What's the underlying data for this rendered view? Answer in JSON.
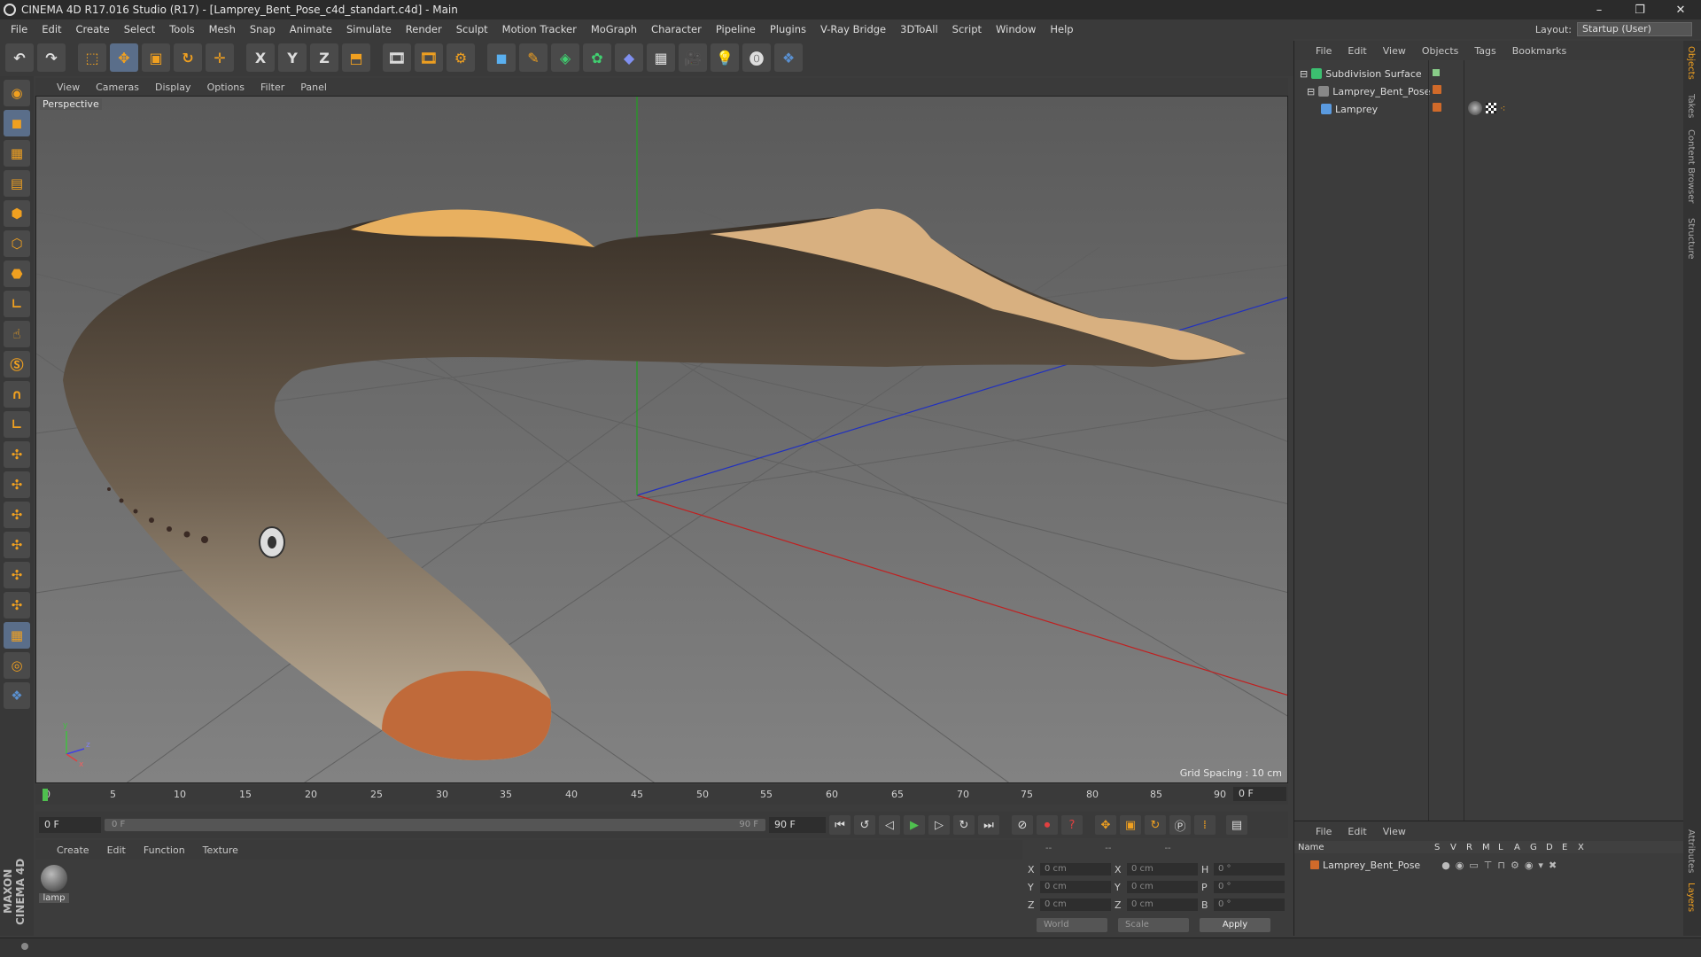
{
  "title": "CINEMA 4D R17.016 Studio (R17) - [Lamprey_Bent_Pose_c4d_standart.c4d] - Main",
  "window_controls": [
    "–",
    "❐",
    "✕"
  ],
  "menu": [
    "File",
    "Edit",
    "Create",
    "Select",
    "Tools",
    "Mesh",
    "Snap",
    "Animate",
    "Simulate",
    "Render",
    "Sculpt",
    "Motion Tracker",
    "MoGraph",
    "Character",
    "Pipeline",
    "Plugins",
    "V-Ray Bridge",
    "3DToAll",
    "Script",
    "Window",
    "Help"
  ],
  "layout": {
    "label": "Layout:",
    "value": "Startup (User)"
  },
  "toolbar_icons": [
    "undo-icon",
    "redo-icon",
    "live-select-icon",
    "move-icon",
    "scale-icon",
    "rotate-icon",
    "transform-icon",
    "x-axis-icon",
    "y-axis-icon",
    "z-axis-icon",
    "world-coord-icon",
    "render-view-icon",
    "render-picture-viewer-icon",
    "render-settings-icon",
    "cube-icon",
    "pen-spline-icon",
    "subdivision-icon",
    "array-icon",
    "deformer-icon",
    "floor-icon",
    "camera-icon",
    "light-icon",
    "vray-icon",
    "python-icon"
  ],
  "toolbar_glyphs": {
    "x": "X",
    "y": "Y",
    "z": "Z"
  },
  "viewport": {
    "menu": [
      "View",
      "Cameras",
      "Display",
      "Options",
      "Filter",
      "Panel"
    ],
    "label": "Perspective",
    "grid_spacing": "Grid Spacing : 10 cm",
    "axis_letters": {
      "y": "y",
      "z": "z",
      "x": "x"
    }
  },
  "timeline": {
    "ticks": [
      "0",
      "5",
      "10",
      "15",
      "20",
      "25",
      "30",
      "35",
      "40",
      "45",
      "50",
      "55",
      "60",
      "65",
      "70",
      "75",
      "80",
      "85",
      "90"
    ],
    "current_frame": "0 F"
  },
  "transport": {
    "start_field": "0 F",
    "range_start": "0 F",
    "range_end": "90 F",
    "end_field": "90 F"
  },
  "material_manager": {
    "menu": [
      "Create",
      "Edit",
      "Function",
      "Texture"
    ],
    "material_name": "lamp"
  },
  "coordinates": {
    "header": [
      "--",
      "--",
      "--"
    ],
    "rows": [
      {
        "a": "X",
        "av": "0 cm",
        "b": "X",
        "bv": "0 cm",
        "c": "H",
        "cv": "0 °"
      },
      {
        "a": "Y",
        "av": "0 cm",
        "b": "Y",
        "bv": "0 cm",
        "c": "P",
        "cv": "0 °"
      },
      {
        "a": "Z",
        "av": "0 cm",
        "b": "Z",
        "bv": "0 cm",
        "c": "B",
        "cv": "0 °"
      }
    ],
    "mode1": "World",
    "mode2": "Scale",
    "apply": "Apply"
  },
  "object_manager": {
    "menu": [
      "File",
      "Edit",
      "View",
      "Objects",
      "Tags",
      "Bookmarks"
    ],
    "objects": [
      "Subdivision Surface",
      "Lamprey_Bent_Pose",
      "Lamprey"
    ]
  },
  "layer_manager": {
    "menu": [
      "File",
      "Edit",
      "View"
    ],
    "columns": [
      "Name",
      "S",
      "V",
      "R",
      "M",
      "L",
      "A",
      "G",
      "D",
      "E",
      "X"
    ],
    "layers": [
      "Lamprey_Bent_Pose"
    ]
  },
  "brand": "MAXON CINEMA 4D",
  "side_tabs": [
    "Objects",
    "Takes",
    "Content Browser",
    "Structure",
    "Attributes",
    "Layers"
  ],
  "colors": {
    "accent": "#f0a020",
    "layer_swatch": "#d06a2a",
    "play": "#4fc04f"
  }
}
